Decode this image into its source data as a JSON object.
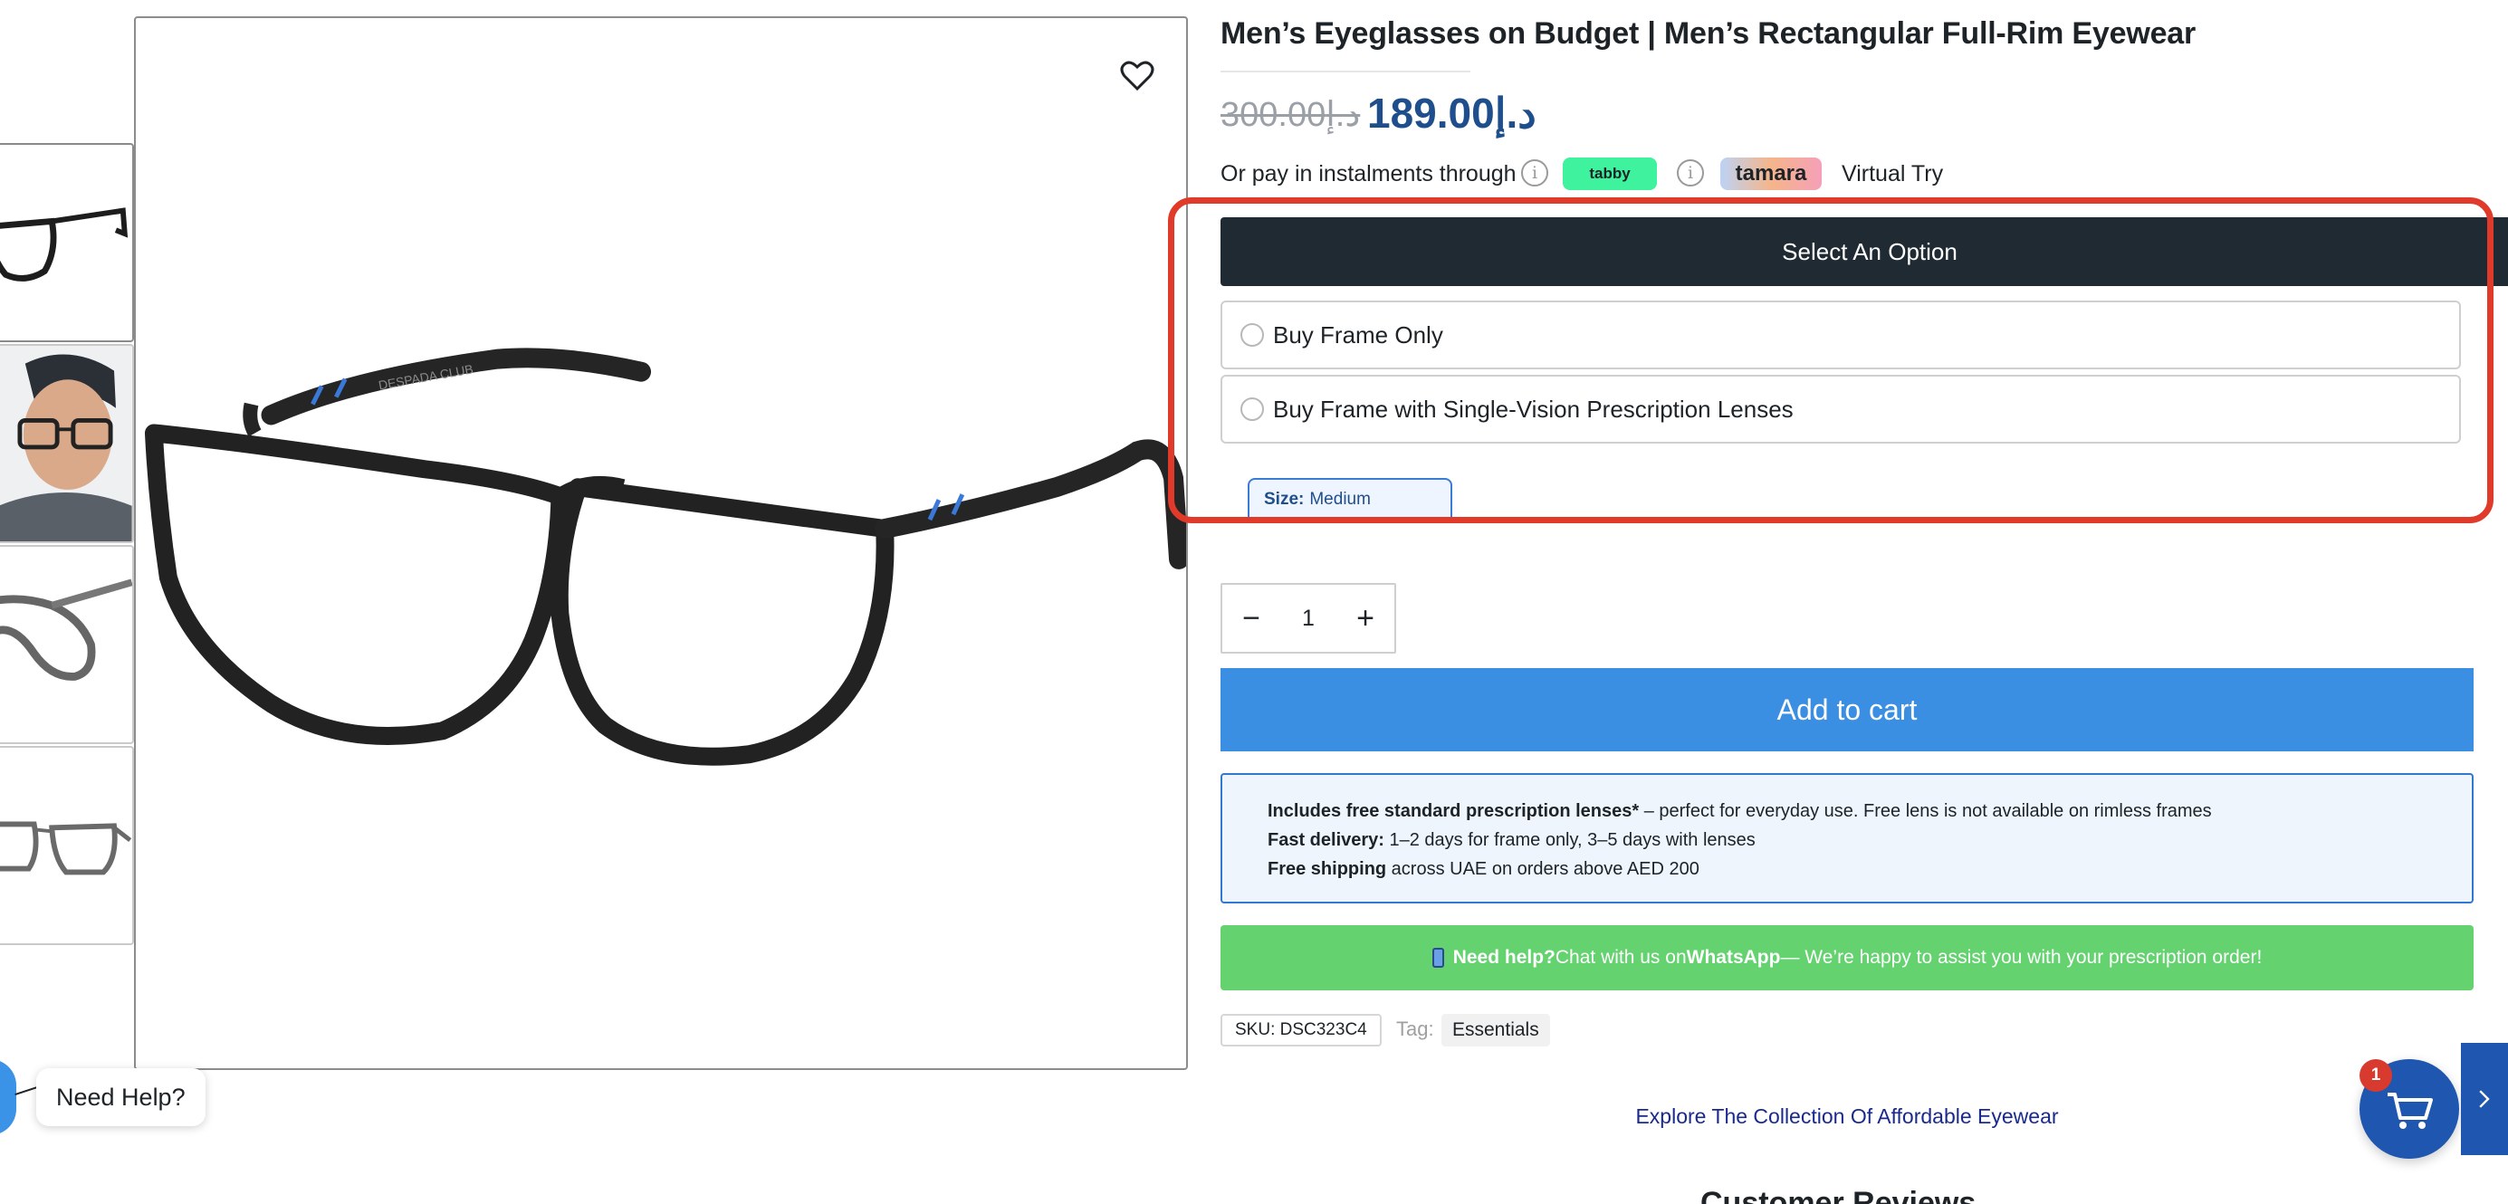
{
  "product": {
    "title": "Men’s Eyeglasses on Budget | Men’s Rectangular Full-Rim Eyewear",
    "price_old": "300.00د.إ",
    "price_new": "189.00د.إ"
  },
  "payment": {
    "text": "Or pay in instalments through",
    "tabby_label": "tabby",
    "tamara_label": "tamara",
    "virtual_try": "Virtual Try"
  },
  "options": {
    "header": "Select An Option",
    "items": [
      {
        "label": "Buy Frame Only",
        "selected": false
      },
      {
        "label": "Buy Frame with Single-Vision Prescription Lenses",
        "selected": false
      }
    ],
    "size_key": "Size:",
    "size_value": "Medium"
  },
  "cart": {
    "minus": "−",
    "quantity": "1",
    "plus": "+",
    "add_to_cart": "Add to cart",
    "badge_count": "1"
  },
  "perks": [
    {
      "bold": "Includes free standard prescription lenses*",
      "rest": " – perfect for everyday use. Free lens is not available on rimless frames"
    },
    {
      "bold": "Fast delivery:",
      "rest": " 1–2 days for frame only, 3–5 days with lenses"
    },
    {
      "bold": "Free shipping",
      "rest": " across UAE on orders above AED 200"
    }
  ],
  "whatsapp": {
    "bold_help": "Need help?",
    "text1": " Chat with us on ",
    "bold_app": "WhatsApp",
    "text2": " — We’re happy to assist you with your prescription order!"
  },
  "meta": {
    "sku": "SKU: DSC323C4",
    "tag_label": "Tag:",
    "tag_value": "Essentials"
  },
  "explore": "Explore The Collection Of Affordable Eyewear",
  "reviews_peek": "Customer Reviews",
  "help": {
    "label": "Need Help?"
  },
  "colors": {
    "accent_blue": "#3b8fe2",
    "price_blue": "#1f4e8c",
    "dark_bar": "#1f2a33",
    "whatsapp_green": "#63d26f",
    "highlight_red": "#e03a2a"
  }
}
